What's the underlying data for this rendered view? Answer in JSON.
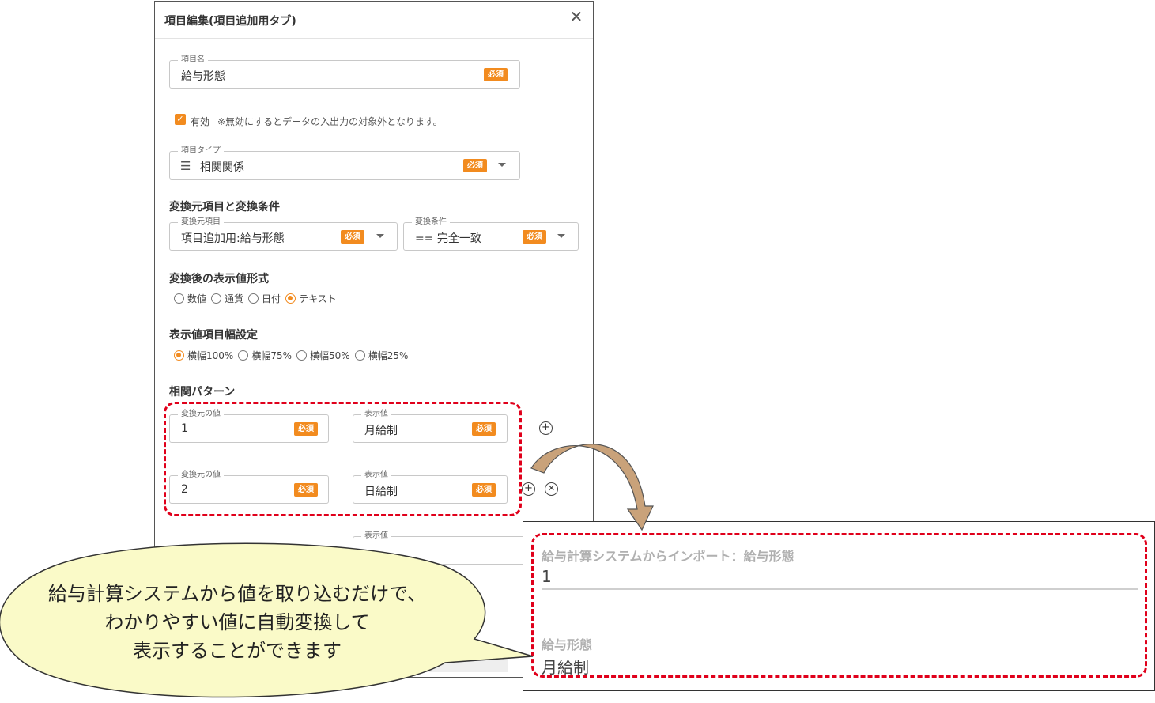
{
  "dialog": {
    "title": "項目編集(項目追加用タブ)",
    "close_icon": "close-icon",
    "required_badge": "必須",
    "item_name": {
      "label": "項目名",
      "value": "給与形態"
    },
    "valid": {
      "label": "有効",
      "note": "※無効にするとデータの入出力の対象外となります。",
      "checked": true
    },
    "item_type": {
      "label": "項目タイプ",
      "value": "相関関係",
      "icon": "list-icon"
    },
    "conversion": {
      "section_title": "変換元項目と変換条件",
      "source_label": "変換元項目",
      "source_value": "項目追加用:給与形態",
      "condition_label": "変換条件",
      "condition_value": "== 完全一致"
    },
    "display_format": {
      "section_title": "変換後の表示値形式",
      "options": [
        "数値",
        "通貨",
        "日付",
        "テキスト"
      ],
      "selected": "テキスト"
    },
    "display_width": {
      "section_title": "表示値項目幅設定",
      "options": [
        "横幅100%",
        "横幅75%",
        "横幅50%",
        "横幅25%"
      ],
      "selected": "横幅100%"
    },
    "pattern": {
      "section_title": "相関パターン",
      "source_label": "変換元の値",
      "display_label": "表示値",
      "rows": [
        {
          "source": "1",
          "display": "月給制"
        },
        {
          "source": "2",
          "display": "日給制"
        }
      ],
      "extra_display_label": "表示値"
    }
  },
  "preview": {
    "field1_label": "給与計算システムからインポート：給与形態",
    "field1_value": "1",
    "field2_label": "給与形態",
    "field2_value": "月給制"
  },
  "callout": {
    "line1": "給与計算システムから値を取り込むだけで、",
    "line2": "わかりやすい値に自動変換して",
    "line3": "表示することができます"
  },
  "colors": {
    "accent": "#f28b1f",
    "highlight": "#e0001b",
    "callout_fill": "#fafac8"
  }
}
